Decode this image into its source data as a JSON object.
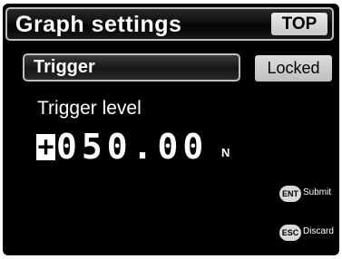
{
  "header": {
    "title": "Graph settings",
    "top_button": "TOP"
  },
  "trigger": {
    "label": "Trigger",
    "status": "Locked"
  },
  "level": {
    "label": "Trigger level",
    "sign": "+",
    "digits": "050.00",
    "unit": "N"
  },
  "hints": {
    "submit_key": "ENT",
    "submit_label": "Submit",
    "discard_key": "ESC",
    "discard_label": "Discard"
  },
  "colors": {
    "background": "#000000",
    "text": "#ffffff",
    "button": "#cfcfcf",
    "border": "#bdbdbd"
  }
}
